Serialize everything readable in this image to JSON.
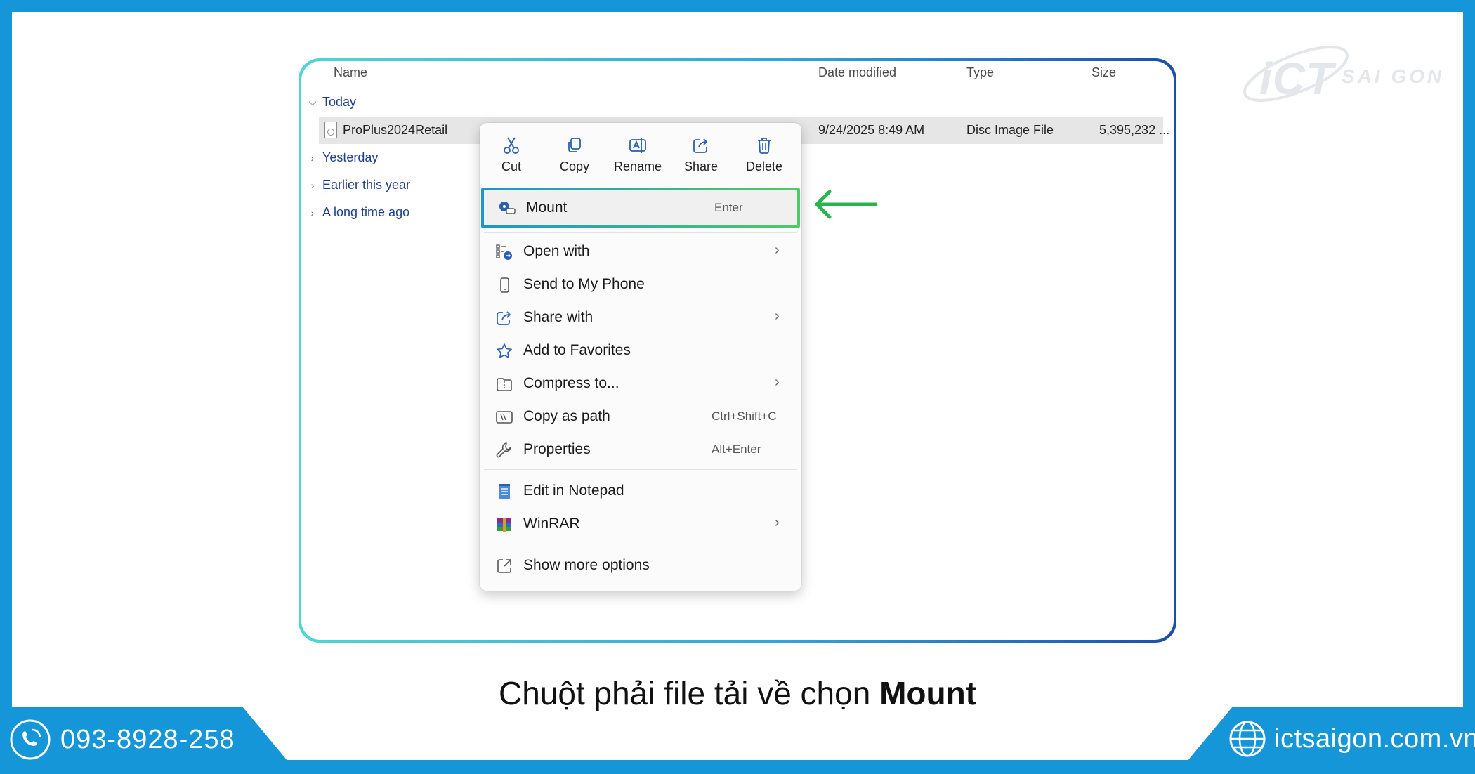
{
  "brand": {
    "logo_main": "iCT",
    "logo_sub": "SAI GON",
    "frame_color": "#1596d9"
  },
  "explorer": {
    "columns": [
      "Name",
      "Date modified",
      "Type",
      "Size"
    ],
    "groups": [
      {
        "label": "Today",
        "expanded": true
      },
      {
        "label": "Yesterday",
        "expanded": false
      },
      {
        "label": "Earlier this year",
        "expanded": false
      },
      {
        "label": "A long time ago",
        "expanded": false
      }
    ],
    "file": {
      "name": "ProPlus2024Retail",
      "date": "9/24/2025 8:49 AM",
      "type": "Disc Image File",
      "size": "5,395,232 ..."
    }
  },
  "context_menu": {
    "actions": [
      {
        "label": "Cut",
        "icon": "scissors-icon"
      },
      {
        "label": "Copy",
        "icon": "copy-icon"
      },
      {
        "label": "Rename",
        "icon": "rename-icon"
      },
      {
        "label": "Share",
        "icon": "share-icon"
      },
      {
        "label": "Delete",
        "icon": "trash-icon"
      }
    ],
    "mount": {
      "label": "Mount",
      "shortcut": "Enter",
      "icon": "disc-mount-icon"
    },
    "items": [
      {
        "label": "Open with",
        "shortcut": "",
        "submenu": true,
        "icon": "open-with-icon"
      },
      {
        "label": "Send to My Phone",
        "shortcut": "",
        "submenu": false,
        "icon": "phone-icon"
      },
      {
        "label": "Share with",
        "shortcut": "",
        "submenu": true,
        "icon": "share-with-icon"
      },
      {
        "label": "Add to Favorites",
        "shortcut": "",
        "submenu": false,
        "icon": "star-icon"
      },
      {
        "label": "Compress to...",
        "shortcut": "",
        "submenu": true,
        "icon": "compress-icon"
      },
      {
        "label": "Copy as path",
        "shortcut": "Ctrl+Shift+C",
        "submenu": false,
        "icon": "copy-path-icon"
      },
      {
        "label": "Properties",
        "shortcut": "Alt+Enter",
        "submenu": false,
        "icon": "wrench-icon"
      },
      {
        "label": "Edit in Notepad",
        "shortcut": "",
        "submenu": false,
        "icon": "notepad-icon"
      },
      {
        "label": "WinRAR",
        "shortcut": "",
        "submenu": true,
        "icon": "winrar-icon"
      },
      {
        "label": "Show more options",
        "shortcut": "",
        "submenu": false,
        "icon": "more-options-icon"
      }
    ]
  },
  "caption": {
    "text": "Chuột phải file tải về chọn ",
    "bold": "Mount"
  },
  "footer": {
    "phone": "093-8928-258",
    "website": "ictsaigon.com.vn"
  }
}
